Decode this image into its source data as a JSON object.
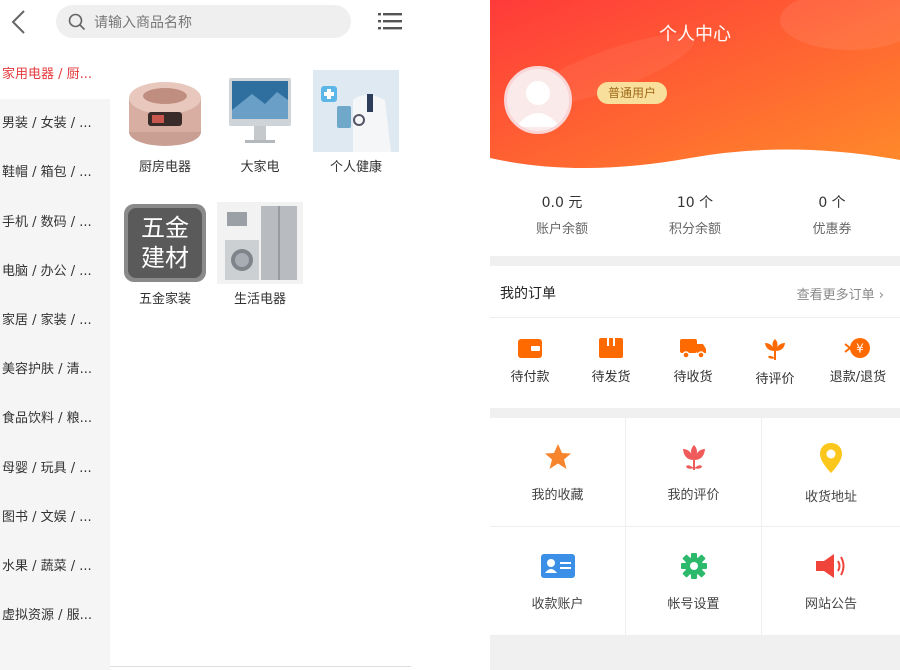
{
  "left": {
    "search": {
      "placeholder": "请输入商品名称"
    },
    "categories": [
      "家用电器 / 厨...",
      "男装 / 女装 / ...",
      "鞋帽 / 箱包 / ...",
      "手机 / 数码 / ...",
      "电脑 / 办公 / ...",
      "家居 / 家装 / ...",
      "美容护肤 / 清...",
      "食品饮料 / 粮...",
      "母婴 / 玩具 / ...",
      "图书 / 文娱 / ...",
      "水果 / 蔬菜 / ...",
      "虚拟资源 / 服..."
    ],
    "goods": [
      {
        "name": "厨房电器"
      },
      {
        "name": "大家电"
      },
      {
        "name": "个人健康"
      },
      {
        "name": "五金家装",
        "thumb_text_1": "五金",
        "thumb_text_2": "建材"
      },
      {
        "name": "生活电器"
      }
    ]
  },
  "right": {
    "title": "个人中心",
    "user_level": "普通用户",
    "stats": [
      {
        "value": "0.0 元",
        "label": "账户余额"
      },
      {
        "value": "10 个",
        "label": "积分余额"
      },
      {
        "value": "0 个",
        "label": "优惠券"
      }
    ],
    "orders": {
      "title": "我的订单",
      "more": "查看更多订单 ›",
      "items": [
        {
          "label": "待付款",
          "icon": "wallet-icon"
        },
        {
          "label": "待发货",
          "icon": "box-icon"
        },
        {
          "label": "待收货",
          "icon": "truck-icon"
        },
        {
          "label": "待评价",
          "icon": "flower-icon"
        },
        {
          "label": "退款/退货",
          "icon": "refund-icon",
          "glyph": "¥"
        }
      ]
    },
    "tools": [
      {
        "label": "我的收藏",
        "icon": "star-icon"
      },
      {
        "label": "我的评价",
        "icon": "tulip-icon"
      },
      {
        "label": "收货地址",
        "icon": "location-pin-icon"
      },
      {
        "label": "收款账户",
        "icon": "id-card-icon"
      },
      {
        "label": "帐号设置",
        "icon": "gear-icon"
      },
      {
        "label": "网站公告",
        "icon": "megaphone-icon"
      }
    ]
  },
  "colors": {
    "accent_red": "#e4393c",
    "header_gradient_start": "#ff3a3a",
    "header_gradient_end": "#ff8a2a",
    "order_icon_orange": "#ff6a00",
    "badge_bg": "#f8df9b"
  }
}
